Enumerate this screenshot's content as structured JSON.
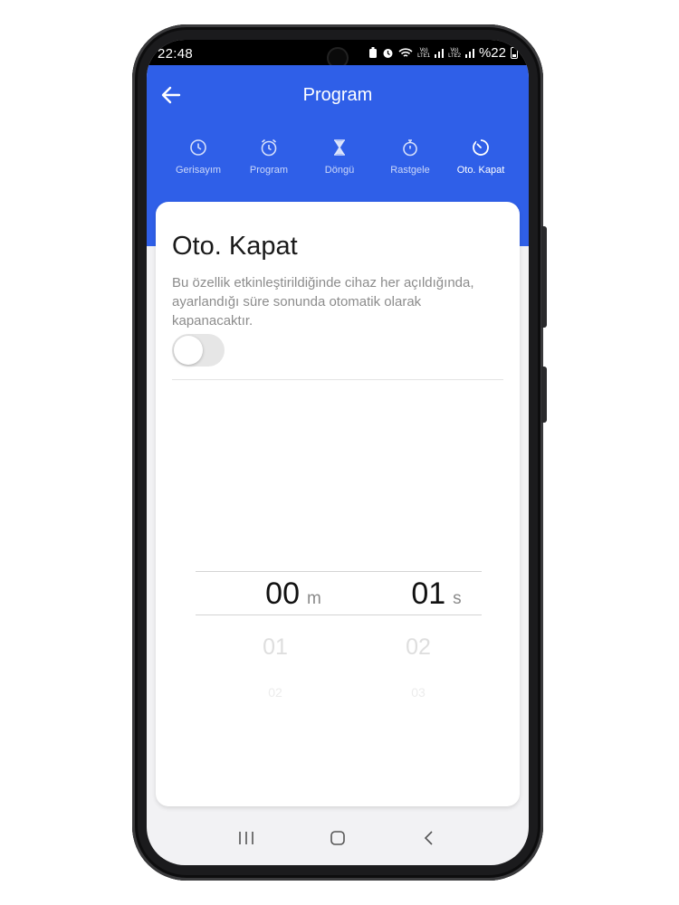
{
  "status_bar": {
    "time": "22:48",
    "battery_percent": "%22",
    "sim1_operator": "Vo)",
    "sim1_net": "LTE1",
    "sim2_operator": "Vo)",
    "sim2_net": "LTE2"
  },
  "header": {
    "title": "Program",
    "back_icon": "arrow-left-icon",
    "color": "#2f5fe8"
  },
  "tabs": [
    {
      "label": "Gerisayım",
      "icon": "clock-icon",
      "active": false
    },
    {
      "label": "Program",
      "icon": "alarm-clock-icon",
      "active": false
    },
    {
      "label": "Döngü",
      "icon": "hourglass-icon",
      "active": false
    },
    {
      "label": "Rastgele",
      "icon": "stopwatch-icon",
      "active": false
    },
    {
      "label": "Oto. Kapat",
      "icon": "timer-off-icon",
      "active": true
    }
  ],
  "card": {
    "title": "Oto. Kapat",
    "description": "Bu özellik etkinleştirildiğinde   cihaz her açıldığında,\nayarlandığı  süre sonunda otomatik olarak\nkapanacaktır.",
    "toggle_on": false
  },
  "picker": {
    "minutes": {
      "value": "00",
      "unit": "m",
      "next": "01",
      "next2": "02"
    },
    "seconds": {
      "value": "01",
      "unit": "s",
      "next": "02",
      "next2": "03"
    }
  },
  "navbar": {
    "recent_icon": "recent-apps-icon",
    "home_icon": "home-icon",
    "back_icon": "back-chevron-icon"
  }
}
